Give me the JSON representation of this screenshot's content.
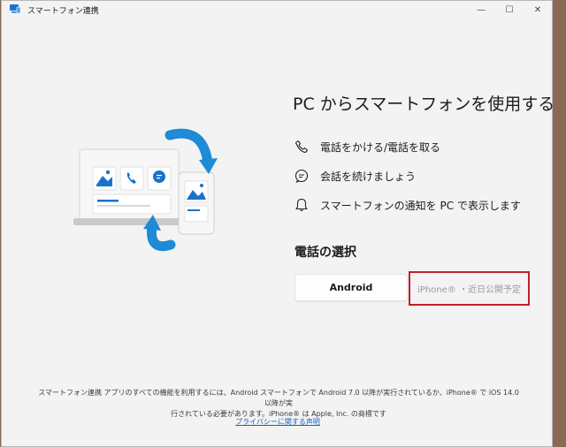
{
  "window": {
    "title": "スマートフォン連携"
  },
  "controls": {
    "minimize": "—",
    "maximize": "☐",
    "close": "✕"
  },
  "main": {
    "heading": "PC からスマートフォンを使用する",
    "features": [
      {
        "icon": "phone-icon",
        "label": "電話をかける/電話を取る"
      },
      {
        "icon": "chat-icon",
        "label": "会話を続けましょう"
      },
      {
        "icon": "bell-icon",
        "label": "スマートフォンの通知を PC で表示します"
      }
    ],
    "select_heading": "電話の選択",
    "android_label": "Android",
    "iphone_label": "iPhone® ・近日公開予定"
  },
  "footer": {
    "note_line1": "スマートフォン連携 アプリのすべての機能を利用するには、Android スマートフォンで Android 7.0 以降が実行されているか、iPhone® で iOS 14.0 以降が実",
    "note_line2": "行されている必要があります。iPhone® は Apple, Inc. の商標です",
    "privacy_link": "プライバシーに関する声明"
  },
  "colors": {
    "accent": "#1a73c9",
    "highlight_border": "#c0202a",
    "link": "#1760b5"
  }
}
